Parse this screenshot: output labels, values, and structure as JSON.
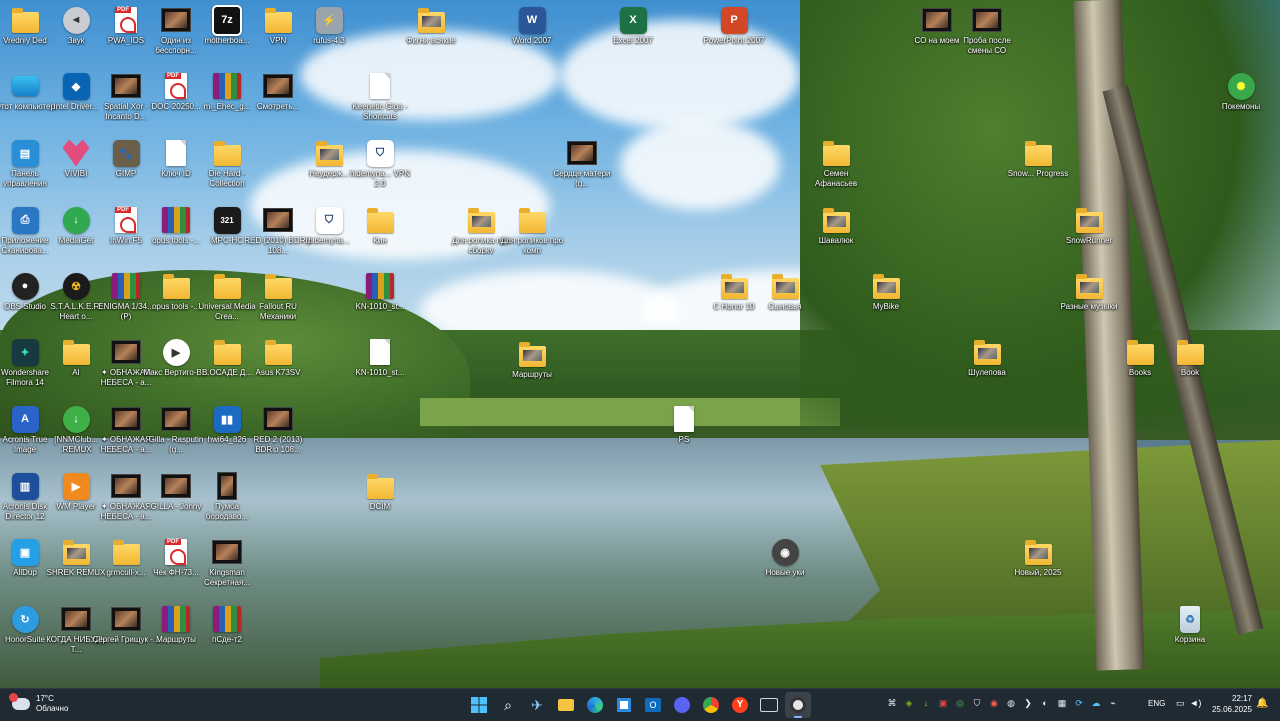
{
  "desktop_icons": {
    "i0": {
      "label": "Vredniy Ded",
      "kind": "folder"
    },
    "i1": {
      "label": "Звук",
      "kind": "speaker"
    },
    "i2": {
      "label": "PWA_IOS",
      "kind": "pdf"
    },
    "i3": {
      "label": "Один из бесспорн...",
      "kind": "video"
    },
    "i4": {
      "label": "motherboa...",
      "kind": "7z"
    },
    "i5": {
      "label": "VPN",
      "kind": "folder"
    },
    "i6": {
      "label": "rufus-4.3",
      "kind": "usb"
    },
    "i7": {
      "label": "Фигни всякие",
      "kind": "folder-pic"
    },
    "i8": {
      "label": "Word 2007",
      "kind": "word"
    },
    "i9": {
      "label": "Excel 2007",
      "kind": "excel"
    },
    "i10": {
      "label": "PowerPoint 2007",
      "kind": "ppt"
    },
    "i11": {
      "label": "СО на моем",
      "kind": "video"
    },
    "i12": {
      "label": "Проба после смены СО",
      "kind": "video"
    },
    "i13": {
      "label": "Этот компьютер",
      "kind": "monitor"
    },
    "i14": {
      "label": "Intel Driver...",
      "kind": "intel"
    },
    "i15": {
      "label": "Spatial Xor - Incanto D...",
      "kind": "video"
    },
    "i16": {
      "label": "DOC-20250...",
      "kind": "pdf"
    },
    "i17": {
      "label": "ml_Ehec_g...",
      "kind": "rar"
    },
    "i18": {
      "label": "Смотреть...",
      "kind": "video"
    },
    "i19": {
      "label": "Keenetic Giga - Shortcuts",
      "kind": "doc"
    },
    "i20": {
      "label": "Покемоны",
      "kind": "pokemon"
    },
    "i21": {
      "label": "Панель управления",
      "kind": "control"
    },
    "i22": {
      "label": "VIVIBI",
      "kind": "vivibi"
    },
    "i23": {
      "label": "GIMP",
      "kind": "gimp"
    },
    "i24": {
      "label": "Ключ ID",
      "kind": "doc"
    },
    "i25": {
      "label": "Die Hard - Collection",
      "kind": "folder"
    },
    "i26": {
      "label": "Неудерж...",
      "kind": "folder-pic"
    },
    "i27": {
      "label": "hidemyna... VPN 2.0",
      "kind": "hidemy"
    },
    "i28": {
      "label": "Сердце матери (g...",
      "kind": "video"
    },
    "i29": {
      "label": "Семен Афанасьев",
      "kind": "folder"
    },
    "i30": {
      "label": "Snow... Progress",
      "kind": "folder"
    },
    "i31": {
      "label": "Приложение Сканирова...",
      "kind": "scanner"
    },
    "i32": {
      "label": "MediaGet",
      "kind": "mediaget"
    },
    "i33": {
      "label": "InWin F5",
      "kind": "pdf"
    },
    "i34": {
      "label": "opus tools -...",
      "kind": "rar"
    },
    "i35": {
      "label": "MPC-HC",
      "kind": "mpc"
    },
    "i36": {
      "label": "RED (2010) BDRip 108...",
      "kind": "video"
    },
    "i37": {
      "label": "hidemyna...",
      "kind": "hidemy"
    },
    "i38": {
      "label": "Кин",
      "kind": "folder"
    },
    "i39": {
      "label": "Для ролика про сборку",
      "kind": "folder-pic"
    },
    "i40": {
      "label": "Для роликов про комп",
      "kind": "folder"
    },
    "i41": {
      "label": "Шавалюк",
      "kind": "folder-pic"
    },
    "i42": {
      "label": "SnowRunner",
      "kind": "folder-pic"
    },
    "i43": {
      "label": "OBS Studio",
      "kind": "obs"
    },
    "i44": {
      "label": "S.T.A.L.K.E.R. Heart o...",
      "kind": "stalker"
    },
    "i45": {
      "label": "ENIGMA 1/34... (P)",
      "kind": "rar"
    },
    "i46": {
      "label": "opus tools -...",
      "kind": "folder"
    },
    "i47": {
      "label": "Universal Media Crea...",
      "kind": "folder"
    },
    "i48": {
      "label": "Fallout RU Механики",
      "kind": "folder"
    },
    "i49": {
      "label": "KN-1010_st...",
      "kind": "rar"
    },
    "i50": {
      "label": "С Honor 10",
      "kind": "folder-pic"
    },
    "i51": {
      "label": "Сыновья",
      "kind": "folder-pic"
    },
    "i52": {
      "label": "MyBike",
      "kind": "folder-pic"
    },
    "i53": {
      "label": "Разные музыки",
      "kind": "folder-pic"
    },
    "i54": {
      "label": "Wondershare Filmora 14",
      "kind": "filmora"
    },
    "i55": {
      "label": "AI",
      "kind": "folder"
    },
    "i56": {
      "label": "✦ ОБНАЖАЯ НЕБЕСА - a...",
      "kind": "video"
    },
    "i57": {
      "label": "Макс Вертиго-В...",
      "kind": "play"
    },
    "i58": {
      "label": "В.ОСАДЕ Д...",
      "kind": "folder"
    },
    "i59": {
      "label": "Asus K73SV",
      "kind": "folder"
    },
    "i60": {
      "label": "KN-1010_st...",
      "kind": "doc"
    },
    "i61": {
      "label": "Маршруты",
      "kind": "folder-pic"
    },
    "i62": {
      "label": "Шулепова",
      "kind": "folder-pic"
    },
    "i63": {
      "label": "Books",
      "kind": "folder"
    },
    "i64": {
      "label": "Book",
      "kind": "folder"
    },
    "i65": {
      "label": "Acronis True Image",
      "kind": "acronis"
    },
    "i66": {
      "label": "[NNMClub... .REMUX",
      "kind": "utorrent"
    },
    "i67": {
      "label": "✦ ОБНАЖАЯ НЕБЕСА - a...",
      "kind": "video"
    },
    "i68": {
      "label": "Gilla - Rasputin (g...",
      "kind": "video"
    },
    "i69": {
      "label": "hwi64_826",
      "kind": "hwi"
    },
    "i70": {
      "label": "RED 2 (2013) BDRip 108...",
      "kind": "video"
    },
    "i71": {
      "label": "PS",
      "kind": "doc"
    },
    "i72": {
      "label": "Acronis Disk Director 12",
      "kind": "acronis-disk"
    },
    "i73": {
      "label": "WM Player",
      "kind": "wmp"
    },
    "i74": {
      "label": "✦ ОБНАЖАЯ НЕБЕСА - a...",
      "kind": "video"
    },
    "i75": {
      "label": "GILLA - Jonny",
      "kind": "video"
    },
    "i76": {
      "label": "Пумба бородаво...",
      "kind": "video"
    },
    "i77": {
      "label": "DCIM",
      "kind": "folder"
    },
    "i78": {
      "label": "AllDup",
      "kind": "alldup"
    },
    "i79": {
      "label": "SHREK REMUX",
      "kind": "folder"
    },
    "i80": {
      "label": "grmcull-x...",
      "kind": "folder"
    },
    "i81": {
      "label": "Чек ФН-73...",
      "kind": "pdf"
    },
    "i82": {
      "label": "Kingsman Секретная...",
      "kind": "video"
    },
    "i83": {
      "label": "Новые уки",
      "kind": "camera"
    },
    "i84": {
      "label": "Новый, 2025",
      "kind": "folder-pic"
    },
    "i85": {
      "label": "HonorSuite",
      "kind": "honor"
    },
    "i86": {
      "label": "КОГДА НИБУДЬ Т...",
      "kind": "video"
    },
    "i87": {
      "label": "Сергей Грищук -...",
      "kind": "video"
    },
    "i88": {
      "label": "Маршруты",
      "kind": "rar"
    },
    "i89": {
      "label": "пСде-т2",
      "kind": "rar"
    },
    "i90": {
      "label": "Корзина",
      "kind": "recycle"
    }
  },
  "taskbar": {
    "weather": {
      "temp": "17°C",
      "condition": "Облачно",
      "icon": "cloud-icon"
    },
    "apps": [
      {
        "name": "start-button",
        "glyph": "⊞"
      },
      {
        "name": "search-button",
        "glyph": "🔍"
      },
      {
        "name": "app-flight",
        "glyph": "✈"
      },
      {
        "name": "app-file-explorer",
        "glyph": "📁"
      },
      {
        "name": "app-edge",
        "glyph": "◐"
      },
      {
        "name": "app-store",
        "glyph": "▦"
      },
      {
        "name": "app-outlook",
        "glyph": "✉"
      },
      {
        "name": "app-discord",
        "glyph": "◉"
      },
      {
        "name": "app-chrome",
        "glyph": "◎"
      },
      {
        "name": "app-yandex",
        "glyph": "Y"
      },
      {
        "name": "app-terminal",
        "glyph": "▭"
      },
      {
        "name": "app-obs",
        "glyph": "◌"
      }
    ],
    "language": "ENG",
    "time": "22:17",
    "date": "25.06.2025"
  }
}
